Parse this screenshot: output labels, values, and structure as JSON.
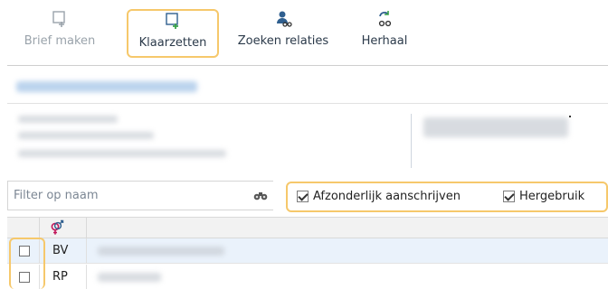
{
  "toolbar": {
    "brief_maken": "Brief maken",
    "klaarzetten": "Klaarzetten",
    "zoeken_relaties": "Zoeken relaties",
    "herhaal": "Herhaal"
  },
  "filter": {
    "placeholder": "Filter op naam"
  },
  "options": {
    "afzonderlijk": "Afzonderlijk aanschrijven",
    "hergebruik": "Hergebruik"
  },
  "rows": [
    {
      "initials": "BV"
    },
    {
      "initials": "RP"
    }
  ],
  "colors": {
    "highlight": "#f6c86b",
    "icon_green": "#3aa34a",
    "icon_blue": "#2f5f8f",
    "gender_icon": "#c2185b"
  }
}
